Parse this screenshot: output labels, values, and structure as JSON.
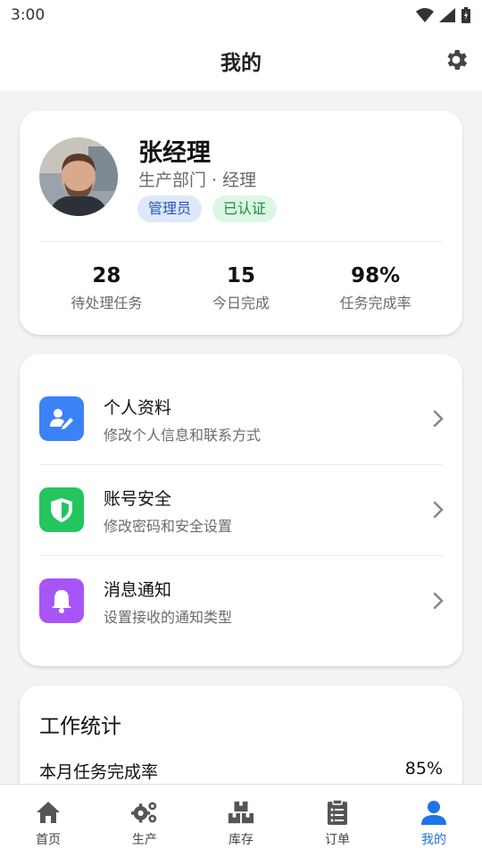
{
  "status_bar": {
    "time": "3:00"
  },
  "app_bar": {
    "title": "我的"
  },
  "profile": {
    "name": "张经理",
    "department": "生产部门 · 经理",
    "badges": [
      "管理员",
      "已认证"
    ],
    "stats": [
      {
        "value": "28",
        "label": "待处理任务"
      },
      {
        "value": "15",
        "label": "今日完成"
      },
      {
        "value": "98%",
        "label": "任务完成率"
      }
    ]
  },
  "menu": [
    {
      "title": "个人资料",
      "subtitle": "修改个人信息和联系方式",
      "icon": "user-edit-icon",
      "color": "#3b82f6"
    },
    {
      "title": "账号安全",
      "subtitle": "修改密码和安全设置",
      "icon": "shield-icon",
      "color": "#22c55e"
    },
    {
      "title": "消息通知",
      "subtitle": "设置接收的通知类型",
      "icon": "bell-icon",
      "color": "#a855f7"
    }
  ],
  "work_stats": {
    "title": "工作统计",
    "rows": [
      {
        "label": "本月任务完成率",
        "value": "85%"
      }
    ]
  },
  "bottom_nav": [
    {
      "label": "首页",
      "icon": "home-icon",
      "active": false
    },
    {
      "label": "生产",
      "icon": "gears-icon",
      "active": false
    },
    {
      "label": "库存",
      "icon": "boxes-icon",
      "active": false
    },
    {
      "label": "订单",
      "icon": "clipboard-icon",
      "active": false
    },
    {
      "label": "我的",
      "icon": "user-icon",
      "active": true
    }
  ],
  "colors": {
    "accent": "#1f73e8",
    "inactive_nav": "#444444"
  }
}
